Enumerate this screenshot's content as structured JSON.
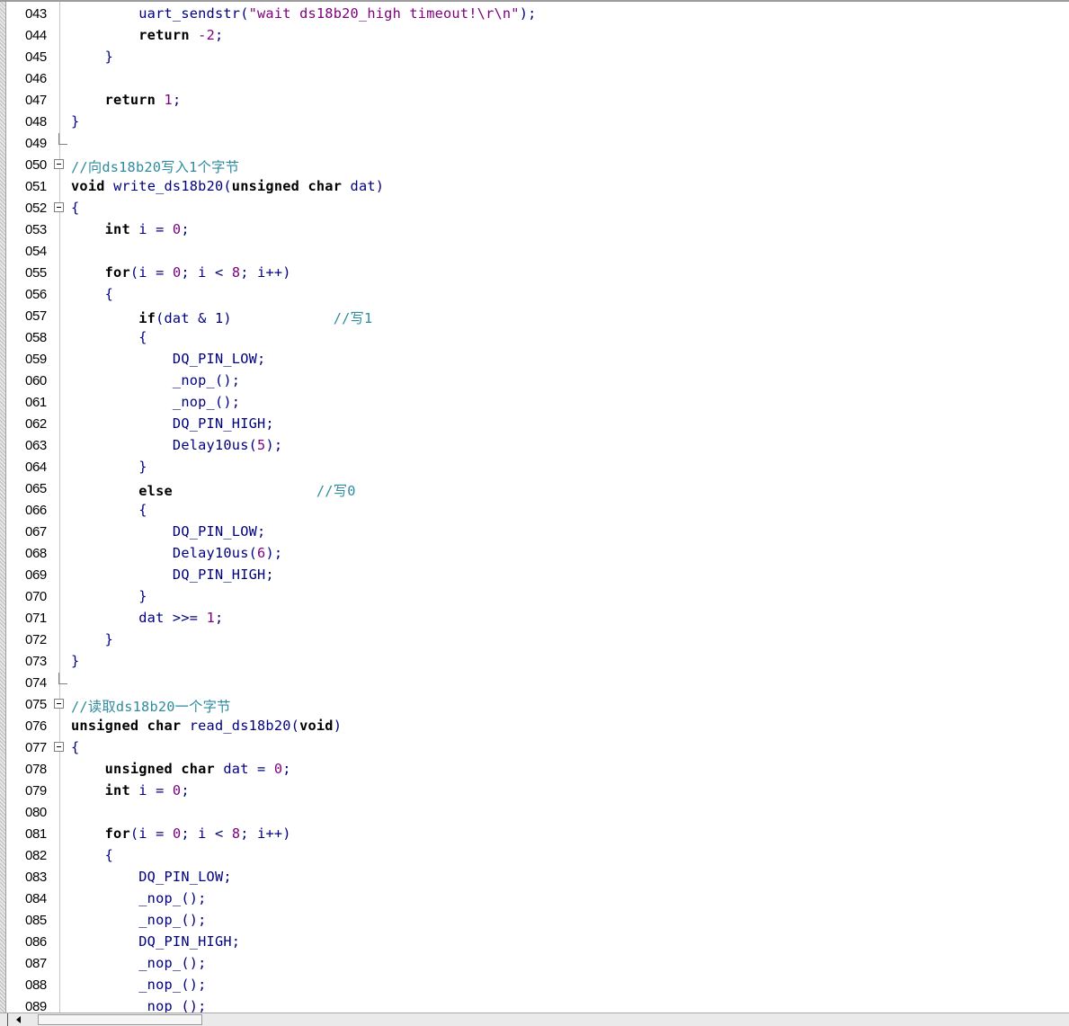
{
  "editor": {
    "lines": [
      {
        "n": "043",
        "fold": "",
        "t": [
          {
            "c": "tx",
            "s": "        uart_sendstr("
          },
          {
            "c": "str",
            "s": "\"wait ds18b20_high timeout!\\r\\n\""
          },
          {
            "c": "tx",
            "s": ");"
          }
        ]
      },
      {
        "n": "044",
        "fold": "",
        "t": [
          {
            "c": "kw",
            "s": "        return "
          },
          {
            "c": "num",
            "s": "-2"
          },
          {
            "c": "tx",
            "s": ";"
          }
        ]
      },
      {
        "n": "045",
        "fold": "",
        "t": [
          {
            "c": "tx",
            "s": "    }"
          }
        ]
      },
      {
        "n": "046",
        "fold": "",
        "t": []
      },
      {
        "n": "047",
        "fold": "",
        "t": [
          {
            "c": "kw",
            "s": "    return "
          },
          {
            "c": "num",
            "s": "1"
          },
          {
            "c": "tx",
            "s": ";"
          }
        ]
      },
      {
        "n": "048",
        "fold": "",
        "t": [
          {
            "c": "tx",
            "s": "}"
          }
        ]
      },
      {
        "n": "049",
        "fold": "end",
        "t": []
      },
      {
        "n": "050",
        "fold": "open",
        "t": [
          {
            "c": "cm",
            "s": "//向ds18b20写入1个字节"
          }
        ]
      },
      {
        "n": "051",
        "fold": "",
        "t": [
          {
            "c": "kw",
            "s": "void "
          },
          {
            "c": "tx",
            "s": "write_ds18b20("
          },
          {
            "c": "kw",
            "s": "unsigned char "
          },
          {
            "c": "tx",
            "s": "dat)"
          }
        ]
      },
      {
        "n": "052",
        "fold": "open",
        "t": [
          {
            "c": "tx",
            "s": "{"
          }
        ]
      },
      {
        "n": "053",
        "fold": "",
        "t": [
          {
            "c": "kw",
            "s": "    int "
          },
          {
            "c": "tx",
            "s": "i = "
          },
          {
            "c": "num",
            "s": "0"
          },
          {
            "c": "tx",
            "s": ";"
          }
        ]
      },
      {
        "n": "054",
        "fold": "",
        "t": []
      },
      {
        "n": "055",
        "fold": "",
        "t": [
          {
            "c": "kw",
            "s": "    for"
          },
          {
            "c": "tx",
            "s": "(i = "
          },
          {
            "c": "num",
            "s": "0"
          },
          {
            "c": "tx",
            "s": "; i < "
          },
          {
            "c": "num",
            "s": "8"
          },
          {
            "c": "tx",
            "s": "; i++)"
          }
        ]
      },
      {
        "n": "056",
        "fold": "",
        "t": [
          {
            "c": "tx",
            "s": "    {"
          }
        ]
      },
      {
        "n": "057",
        "fold": "",
        "t": [
          {
            "c": "kw",
            "s": "        if"
          },
          {
            "c": "tx",
            "s": "(dat & 1)            "
          },
          {
            "c": "cm",
            "s": "//写1"
          }
        ]
      },
      {
        "n": "058",
        "fold": "",
        "t": [
          {
            "c": "tx",
            "s": "        {"
          }
        ]
      },
      {
        "n": "059",
        "fold": "",
        "t": [
          {
            "c": "tx",
            "s": "            DQ_PIN_LOW;"
          }
        ]
      },
      {
        "n": "060",
        "fold": "",
        "t": [
          {
            "c": "tx",
            "s": "            _nop_();"
          }
        ]
      },
      {
        "n": "061",
        "fold": "",
        "t": [
          {
            "c": "tx",
            "s": "            _nop_();"
          }
        ]
      },
      {
        "n": "062",
        "fold": "",
        "t": [
          {
            "c": "tx",
            "s": "            DQ_PIN_HIGH;"
          }
        ]
      },
      {
        "n": "063",
        "fold": "",
        "t": [
          {
            "c": "tx",
            "s": "            Delay10us("
          },
          {
            "c": "num",
            "s": "5"
          },
          {
            "c": "tx",
            "s": ");"
          }
        ]
      },
      {
        "n": "064",
        "fold": "",
        "t": [
          {
            "c": "tx",
            "s": "        }"
          }
        ]
      },
      {
        "n": "065",
        "fold": "",
        "t": [
          {
            "c": "kw",
            "s": "        else"
          },
          {
            "c": "tx",
            "s": "                 "
          },
          {
            "c": "cm",
            "s": "//写0"
          }
        ]
      },
      {
        "n": "066",
        "fold": "",
        "t": [
          {
            "c": "tx",
            "s": "        {"
          }
        ]
      },
      {
        "n": "067",
        "fold": "",
        "t": [
          {
            "c": "tx",
            "s": "            DQ_PIN_LOW;"
          }
        ]
      },
      {
        "n": "068",
        "fold": "",
        "t": [
          {
            "c": "tx",
            "s": "            Delay10us("
          },
          {
            "c": "num",
            "s": "6"
          },
          {
            "c": "tx",
            "s": ");"
          }
        ]
      },
      {
        "n": "069",
        "fold": "",
        "t": [
          {
            "c": "tx",
            "s": "            DQ_PIN_HIGH;"
          }
        ]
      },
      {
        "n": "070",
        "fold": "",
        "t": [
          {
            "c": "tx",
            "s": "        }"
          }
        ]
      },
      {
        "n": "071",
        "fold": "",
        "t": [
          {
            "c": "tx",
            "s": "        dat >>= "
          },
          {
            "c": "num",
            "s": "1"
          },
          {
            "c": "tx",
            "s": ";"
          }
        ]
      },
      {
        "n": "072",
        "fold": "",
        "t": [
          {
            "c": "tx",
            "s": "    }"
          }
        ]
      },
      {
        "n": "073",
        "fold": "",
        "t": [
          {
            "c": "tx",
            "s": "}"
          }
        ]
      },
      {
        "n": "074",
        "fold": "end",
        "t": []
      },
      {
        "n": "075",
        "fold": "open",
        "t": [
          {
            "c": "cm",
            "s": "//读取ds18b20一个字节"
          }
        ]
      },
      {
        "n": "076",
        "fold": "",
        "t": [
          {
            "c": "kw",
            "s": "unsigned char "
          },
          {
            "c": "tx",
            "s": "read_ds18b20("
          },
          {
            "c": "kw",
            "s": "void"
          },
          {
            "c": "tx",
            "s": ")"
          }
        ]
      },
      {
        "n": "077",
        "fold": "open",
        "t": [
          {
            "c": "tx",
            "s": "{"
          }
        ]
      },
      {
        "n": "078",
        "fold": "",
        "t": [
          {
            "c": "kw",
            "s": "    unsigned char "
          },
          {
            "c": "tx",
            "s": "dat = "
          },
          {
            "c": "num",
            "s": "0"
          },
          {
            "c": "tx",
            "s": ";"
          }
        ]
      },
      {
        "n": "079",
        "fold": "",
        "t": [
          {
            "c": "kw",
            "s": "    int "
          },
          {
            "c": "tx",
            "s": "i = "
          },
          {
            "c": "num",
            "s": "0"
          },
          {
            "c": "tx",
            "s": ";"
          }
        ]
      },
      {
        "n": "080",
        "fold": "",
        "t": []
      },
      {
        "n": "081",
        "fold": "",
        "t": [
          {
            "c": "kw",
            "s": "    for"
          },
          {
            "c": "tx",
            "s": "(i = "
          },
          {
            "c": "num",
            "s": "0"
          },
          {
            "c": "tx",
            "s": "; i < "
          },
          {
            "c": "num",
            "s": "8"
          },
          {
            "c": "tx",
            "s": "; i++)"
          }
        ]
      },
      {
        "n": "082",
        "fold": "",
        "t": [
          {
            "c": "tx",
            "s": "    {"
          }
        ]
      },
      {
        "n": "083",
        "fold": "",
        "t": [
          {
            "c": "tx",
            "s": "        DQ_PIN_LOW;"
          }
        ]
      },
      {
        "n": "084",
        "fold": "",
        "t": [
          {
            "c": "tx",
            "s": "        _nop_();"
          }
        ]
      },
      {
        "n": "085",
        "fold": "",
        "t": [
          {
            "c": "tx",
            "s": "        _nop_();"
          }
        ]
      },
      {
        "n": "086",
        "fold": "",
        "t": [
          {
            "c": "tx",
            "s": "        DQ_PIN_HIGH;"
          }
        ]
      },
      {
        "n": "087",
        "fold": "",
        "t": [
          {
            "c": "tx",
            "s": "        _nop_();"
          }
        ]
      },
      {
        "n": "088",
        "fold": "",
        "t": [
          {
            "c": "tx",
            "s": "        _nop_();"
          }
        ]
      },
      {
        "n": "089",
        "fold": "",
        "t": [
          {
            "c": "tx",
            "s": "        _nop_();"
          }
        ]
      }
    ]
  },
  "colors": {
    "keyword": "#000000",
    "identifier": "#000080",
    "number": "#800080",
    "comment": "#2e8b9e"
  }
}
